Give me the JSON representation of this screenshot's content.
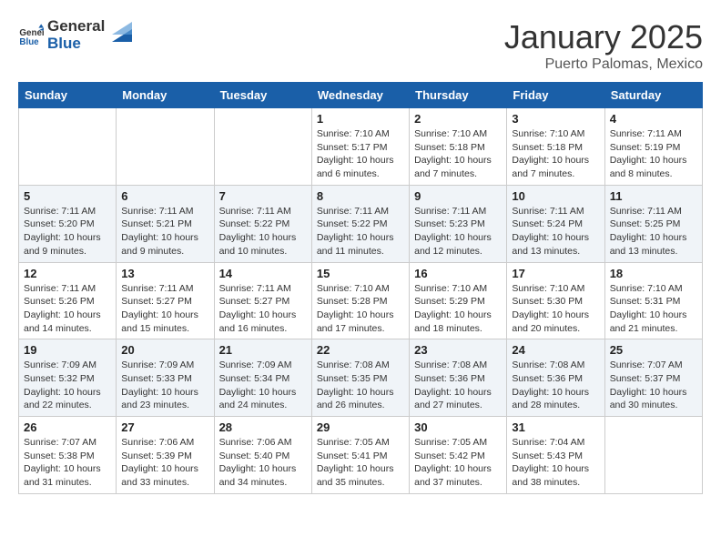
{
  "header": {
    "logo_general": "General",
    "logo_blue": "Blue",
    "month": "January 2025",
    "location": "Puerto Palomas, Mexico"
  },
  "weekdays": [
    "Sunday",
    "Monday",
    "Tuesday",
    "Wednesday",
    "Thursday",
    "Friday",
    "Saturday"
  ],
  "weeks": [
    [
      {
        "day": "",
        "info": ""
      },
      {
        "day": "",
        "info": ""
      },
      {
        "day": "",
        "info": ""
      },
      {
        "day": "1",
        "info": "Sunrise: 7:10 AM\nSunset: 5:17 PM\nDaylight: 10 hours\nand 6 minutes."
      },
      {
        "day": "2",
        "info": "Sunrise: 7:10 AM\nSunset: 5:18 PM\nDaylight: 10 hours\nand 7 minutes."
      },
      {
        "day": "3",
        "info": "Sunrise: 7:10 AM\nSunset: 5:18 PM\nDaylight: 10 hours\nand 7 minutes."
      },
      {
        "day": "4",
        "info": "Sunrise: 7:11 AM\nSunset: 5:19 PM\nDaylight: 10 hours\nand 8 minutes."
      }
    ],
    [
      {
        "day": "5",
        "info": "Sunrise: 7:11 AM\nSunset: 5:20 PM\nDaylight: 10 hours\nand 9 minutes."
      },
      {
        "day": "6",
        "info": "Sunrise: 7:11 AM\nSunset: 5:21 PM\nDaylight: 10 hours\nand 9 minutes."
      },
      {
        "day": "7",
        "info": "Sunrise: 7:11 AM\nSunset: 5:22 PM\nDaylight: 10 hours\nand 10 minutes."
      },
      {
        "day": "8",
        "info": "Sunrise: 7:11 AM\nSunset: 5:22 PM\nDaylight: 10 hours\nand 11 minutes."
      },
      {
        "day": "9",
        "info": "Sunrise: 7:11 AM\nSunset: 5:23 PM\nDaylight: 10 hours\nand 12 minutes."
      },
      {
        "day": "10",
        "info": "Sunrise: 7:11 AM\nSunset: 5:24 PM\nDaylight: 10 hours\nand 13 minutes."
      },
      {
        "day": "11",
        "info": "Sunrise: 7:11 AM\nSunset: 5:25 PM\nDaylight: 10 hours\nand 13 minutes."
      }
    ],
    [
      {
        "day": "12",
        "info": "Sunrise: 7:11 AM\nSunset: 5:26 PM\nDaylight: 10 hours\nand 14 minutes."
      },
      {
        "day": "13",
        "info": "Sunrise: 7:11 AM\nSunset: 5:27 PM\nDaylight: 10 hours\nand 15 minutes."
      },
      {
        "day": "14",
        "info": "Sunrise: 7:11 AM\nSunset: 5:27 PM\nDaylight: 10 hours\nand 16 minutes."
      },
      {
        "day": "15",
        "info": "Sunrise: 7:10 AM\nSunset: 5:28 PM\nDaylight: 10 hours\nand 17 minutes."
      },
      {
        "day": "16",
        "info": "Sunrise: 7:10 AM\nSunset: 5:29 PM\nDaylight: 10 hours\nand 18 minutes."
      },
      {
        "day": "17",
        "info": "Sunrise: 7:10 AM\nSunset: 5:30 PM\nDaylight: 10 hours\nand 20 minutes."
      },
      {
        "day": "18",
        "info": "Sunrise: 7:10 AM\nSunset: 5:31 PM\nDaylight: 10 hours\nand 21 minutes."
      }
    ],
    [
      {
        "day": "19",
        "info": "Sunrise: 7:09 AM\nSunset: 5:32 PM\nDaylight: 10 hours\nand 22 minutes."
      },
      {
        "day": "20",
        "info": "Sunrise: 7:09 AM\nSunset: 5:33 PM\nDaylight: 10 hours\nand 23 minutes."
      },
      {
        "day": "21",
        "info": "Sunrise: 7:09 AM\nSunset: 5:34 PM\nDaylight: 10 hours\nand 24 minutes."
      },
      {
        "day": "22",
        "info": "Sunrise: 7:08 AM\nSunset: 5:35 PM\nDaylight: 10 hours\nand 26 minutes."
      },
      {
        "day": "23",
        "info": "Sunrise: 7:08 AM\nSunset: 5:36 PM\nDaylight: 10 hours\nand 27 minutes."
      },
      {
        "day": "24",
        "info": "Sunrise: 7:08 AM\nSunset: 5:36 PM\nDaylight: 10 hours\nand 28 minutes."
      },
      {
        "day": "25",
        "info": "Sunrise: 7:07 AM\nSunset: 5:37 PM\nDaylight: 10 hours\nand 30 minutes."
      }
    ],
    [
      {
        "day": "26",
        "info": "Sunrise: 7:07 AM\nSunset: 5:38 PM\nDaylight: 10 hours\nand 31 minutes."
      },
      {
        "day": "27",
        "info": "Sunrise: 7:06 AM\nSunset: 5:39 PM\nDaylight: 10 hours\nand 33 minutes."
      },
      {
        "day": "28",
        "info": "Sunrise: 7:06 AM\nSunset: 5:40 PM\nDaylight: 10 hours\nand 34 minutes."
      },
      {
        "day": "29",
        "info": "Sunrise: 7:05 AM\nSunset: 5:41 PM\nDaylight: 10 hours\nand 35 minutes."
      },
      {
        "day": "30",
        "info": "Sunrise: 7:05 AM\nSunset: 5:42 PM\nDaylight: 10 hours\nand 37 minutes."
      },
      {
        "day": "31",
        "info": "Sunrise: 7:04 AM\nSunset: 5:43 PM\nDaylight: 10 hours\nand 38 minutes."
      },
      {
        "day": "",
        "info": ""
      }
    ]
  ]
}
